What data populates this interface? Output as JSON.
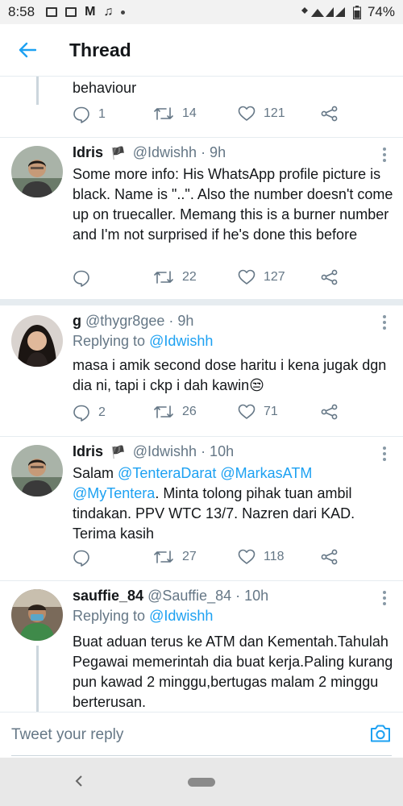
{
  "status_bar": {
    "time": "8:58",
    "battery": "74%"
  },
  "header": {
    "title": "Thread"
  },
  "tweets": [
    {
      "text_tail": "behaviour",
      "replies": "1",
      "retweets": "14",
      "likes": "121"
    },
    {
      "name": "Idris",
      "handle": "@Idwishh",
      "time": "· 9h",
      "text": "Some more info: His WhatsApp profile picture is black. Name is \"..\". Also the number doesn't come up on truecaller. Memang this is a burner number and I'm not surprised if he's done this before",
      "replies": "",
      "retweets": "22",
      "likes": "127"
    },
    {
      "name": "g",
      "handle": "@thygr8gee",
      "time": "· 9h",
      "replying_label": "Replying to",
      "replying_to": "@Idwishh",
      "text": "masa i amik second dose haritu i kena jugak dgn dia ni, tapi i ckp i dah kawin😒",
      "replies": "2",
      "retweets": "26",
      "likes": "71"
    },
    {
      "name": "Idris",
      "handle": "@Idwishh",
      "time": "· 10h",
      "text_start": "Salam",
      "mention1": "@TenteraDarat",
      "mention2": "@MarkasATM",
      "mention3": "@MyTentera",
      "text_end": ". Minta tolong pihak tuan ambil tindakan. PPV WTC 13/7. Nazren dari KAD. Terima kasih",
      "replies": "",
      "retweets": "27",
      "likes": "118"
    },
    {
      "name": "sauffie_84",
      "handle": "@Sauffie_84",
      "time": "· 10h",
      "replying_label": "Replying to",
      "replying_to": "@Idwishh",
      "text": "Buat aduan terus ke ATM dan Kementah.Tahulah Pegawai memerintah dia buat kerja.Paling kurang pun kawad 2 minggu,bertugas malam 2 minggu berterusan."
    }
  ],
  "reply_bar": {
    "placeholder": "Tweet your reply"
  },
  "colors": {
    "accent": "#1da1f2",
    "muted": "#657786",
    "text": "#14171a"
  }
}
